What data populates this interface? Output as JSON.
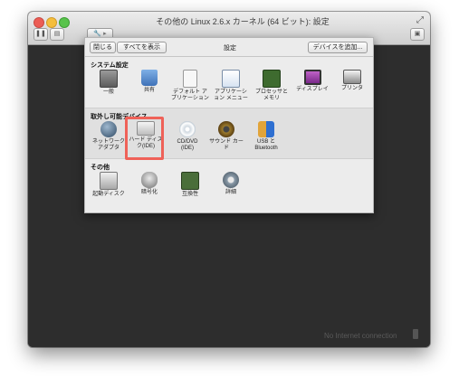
{
  "window": {
    "title": "その他の Linux 2.6.x カーネル (64 ビット): 設定",
    "fullscreen_glyph": "⤢",
    "toolbar": {
      "pause_glyph": "❚❚",
      "snapshot_glyph": "▤",
      "tools_glyph": "🔧 ▸",
      "sidebar_glyph": "▣"
    }
  },
  "dialog": {
    "close_label": "閉じる",
    "show_all_label": "すべてを表示",
    "title": "設定",
    "add_device_label": "デバイスを追加...",
    "sections": {
      "system": {
        "heading": "システム設定",
        "items": [
          {
            "line1": "一般",
            "line2": "",
            "icon": "general-icon"
          },
          {
            "line1": "共有",
            "line2": "",
            "icon": "sharing-icon"
          },
          {
            "line1": "デフォルト ア",
            "line2": "プリケーション",
            "icon": "default-apps-icon"
          },
          {
            "line1": "アプリケーシ",
            "line2": "ョン メニュー",
            "icon": "app-menu-icon"
          },
          {
            "line1": "プロセッサと",
            "line2": "メモリ",
            "icon": "processor-icon"
          },
          {
            "line1": "ディスプレイ",
            "line2": "",
            "icon": "display-icon"
          },
          {
            "line1": "プリンタ",
            "line2": "",
            "icon": "printer-icon"
          }
        ]
      },
      "removable": {
        "heading": "取外し可能デバイス",
        "items": [
          {
            "line1": "ネットワーク",
            "line2": "アダプタ",
            "icon": "network-icon"
          },
          {
            "line1": "ハード ディス",
            "line2": "ク(IDE)",
            "icon": "hard-disk-icon"
          },
          {
            "line1": "CD/DVD",
            "line2": "(IDE)",
            "icon": "cd-dvd-icon"
          },
          {
            "line1": "サウンド カー",
            "line2": "ド",
            "icon": "sound-icon"
          },
          {
            "line1": "USB と",
            "line2": "Bluetooth",
            "icon": "usb-bluetooth-icon"
          }
        ]
      },
      "other": {
        "heading": "その他",
        "items": [
          {
            "line1": "起動ディスク",
            "line2": "",
            "icon": "startup-disk-icon"
          },
          {
            "line1": "暗号化",
            "line2": "",
            "icon": "encryption-icon"
          },
          {
            "line1": "互換性",
            "line2": "",
            "icon": "compatibility-icon"
          },
          {
            "line1": "詳細",
            "line2": "",
            "icon": "advanced-icon"
          }
        ]
      }
    }
  },
  "status": {
    "network_text": "No Internet connection"
  },
  "colors": {
    "highlight": "#ef6158",
    "vm_background": "#2d2d2d"
  }
}
